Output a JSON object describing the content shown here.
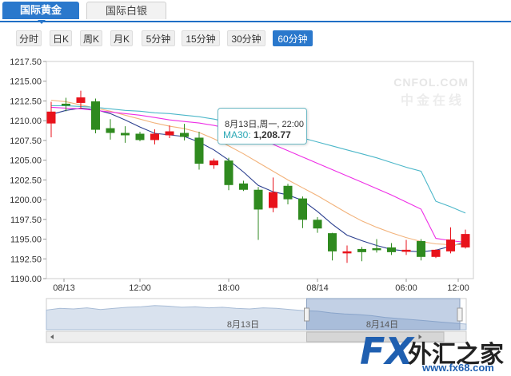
{
  "tabs": [
    {
      "label": "国际黄金",
      "active": true
    },
    {
      "label": "国际白银",
      "active": false
    }
  ],
  "periods": [
    {
      "label": "分时",
      "selected": false
    },
    {
      "label": "日K",
      "selected": false
    },
    {
      "label": "周K",
      "selected": false
    },
    {
      "label": "月K",
      "selected": false
    },
    {
      "label": "5分钟",
      "selected": false
    },
    {
      "label": "15分钟",
      "selected": false
    },
    {
      "label": "30分钟",
      "selected": false
    },
    {
      "label": "60分钟",
      "selected": true
    }
  ],
  "tooltip": {
    "time": "8月13日,周一, 22:00",
    "label": "MA30:",
    "value": "1,208.77"
  },
  "watermark": {
    "line1": "CNFOL.COM",
    "line2": "中金在线"
  },
  "navigator": {
    "label1": "8月13日",
    "label2": "8月14日"
  },
  "logo": {
    "fx": "FX",
    "name": "外汇之家",
    "url": "www.fx68.com"
  },
  "colors": {
    "up": "#e8121b",
    "down": "#2f8a1f",
    "ma_dark": "#2b3f8f",
    "ma_orange": "#f2b27a",
    "ma_magenta": "#ee2ee6",
    "ma_teal": "#4cb7c9",
    "accent": "#2a78cc"
  },
  "chart_data": {
    "type": "candlestick",
    "y_ticks": [
      "1190.00",
      "1192.50",
      "1195.00",
      "1197.50",
      "1200.00",
      "1202.50",
      "1205.00",
      "1207.50",
      "1210.00",
      "1212.50",
      "1215.00",
      "1217.50"
    ],
    "ylim": [
      1190.0,
      1217.5
    ],
    "x_ticks": [
      "08/13",
      "12:00",
      "18:00",
      "08/14",
      "06:00",
      "12:00"
    ],
    "candles": [
      {
        "o": 1209.7,
        "h": 1212.4,
        "l": 1207.9,
        "c": 1211.1
      },
      {
        "o": 1212.1,
        "h": 1212.9,
        "l": 1211.2,
        "c": 1212.0
      },
      {
        "o": 1212.3,
        "h": 1213.8,
        "l": 1211.5,
        "c": 1212.9
      },
      {
        "o": 1212.4,
        "h": 1212.8,
        "l": 1208.4,
        "c": 1208.9
      },
      {
        "o": 1209.0,
        "h": 1210.2,
        "l": 1207.6,
        "c": 1208.5
      },
      {
        "o": 1208.4,
        "h": 1209.3,
        "l": 1207.2,
        "c": 1208.2
      },
      {
        "o": 1208.3,
        "h": 1208.6,
        "l": 1207.4,
        "c": 1207.6
      },
      {
        "o": 1207.6,
        "h": 1208.9,
        "l": 1207.0,
        "c": 1208.3
      },
      {
        "o": 1208.2,
        "h": 1209.4,
        "l": 1207.8,
        "c": 1208.6
      },
      {
        "o": 1208.4,
        "h": 1209.6,
        "l": 1207.5,
        "c": 1208.0
      },
      {
        "o": 1207.8,
        "h": 1208.6,
        "l": 1203.8,
        "c": 1204.6
      },
      {
        "o": 1204.4,
        "h": 1205.2,
        "l": 1203.9,
        "c": 1204.9
      },
      {
        "o": 1204.9,
        "h": 1205.3,
        "l": 1201.2,
        "c": 1201.9
      },
      {
        "o": 1202.0,
        "h": 1202.4,
        "l": 1201.1,
        "c": 1201.3
      },
      {
        "o": 1201.2,
        "h": 1201.6,
        "l": 1194.9,
        "c": 1198.8
      },
      {
        "o": 1199.0,
        "h": 1202.8,
        "l": 1198.4,
        "c": 1200.9
      },
      {
        "o": 1201.7,
        "h": 1202.0,
        "l": 1199.4,
        "c": 1200.1
      },
      {
        "o": 1200.1,
        "h": 1200.4,
        "l": 1196.4,
        "c": 1197.5
      },
      {
        "o": 1197.4,
        "h": 1197.8,
        "l": 1195.8,
        "c": 1196.4
      },
      {
        "o": 1195.7,
        "h": 1195.8,
        "l": 1192.3,
        "c": 1193.5
      },
      {
        "o": 1193.3,
        "h": 1194.2,
        "l": 1192.0,
        "c": 1193.4
      },
      {
        "o": 1193.7,
        "h": 1194.0,
        "l": 1192.2,
        "c": 1193.4
      },
      {
        "o": 1193.8,
        "h": 1195.0,
        "l": 1193.3,
        "c": 1193.7
      },
      {
        "o": 1193.9,
        "h": 1194.5,
        "l": 1193.0,
        "c": 1193.4
      },
      {
        "o": 1193.6,
        "h": 1194.9,
        "l": 1193.0,
        "c": 1193.6
      },
      {
        "o": 1194.7,
        "h": 1195.0,
        "l": 1192.3,
        "c": 1192.8
      },
      {
        "o": 1192.8,
        "h": 1193.7,
        "l": 1192.6,
        "c": 1193.6
      },
      {
        "o": 1193.5,
        "h": 1196.5,
        "l": 1193.2,
        "c": 1194.9
      },
      {
        "o": 1194.0,
        "h": 1196.2,
        "l": 1193.8,
        "c": 1195.6
      }
    ],
    "series": [
      {
        "name": "MA5",
        "values": [
          1210.8,
          1211.3,
          1211.6,
          1211.4,
          1210.9,
          1210.1,
          1209.2,
          1208.4,
          1208.2,
          1208.0,
          1207.3,
          1206.3,
          1205.0,
          1203.5,
          1201.8,
          1201.0,
          1200.6,
          1199.9,
          1198.5,
          1196.9,
          1195.5,
          1194.8,
          1194.2,
          1193.7,
          1193.5,
          1193.4,
          1193.6,
          1194.1,
          1194.6
        ]
      },
      {
        "name": "MA10",
        "values": [
          1212.6,
          1212.4,
          1212.0,
          1211.6,
          1211.2,
          1210.7,
          1210.2,
          1209.7,
          1209.3,
          1209.0,
          1208.5,
          1207.7,
          1206.8,
          1205.8,
          1204.7,
          1203.6,
          1202.5,
          1201.5,
          1200.5,
          1199.4,
          1198.3,
          1197.3,
          1196.5,
          1195.8,
          1195.2,
          1194.7,
          1194.4,
          1194.3,
          1194.3
        ]
      },
      {
        "name": "MA20",
        "values": [
          1211.7,
          1211.6,
          1211.5,
          1211.3,
          1211.1,
          1210.9,
          1210.7,
          1210.4,
          1210.1,
          1209.9,
          1209.7,
          1209.4,
          1209.0,
          1208.4,
          1207.7,
          1207.0,
          1206.2,
          1205.4,
          1204.6,
          1203.8,
          1203.0,
          1202.2,
          1201.4,
          1200.6,
          1199.7,
          1198.8,
          1195.1,
          1194.8,
          1194.6
        ]
      },
      {
        "name": "MA30",
        "values": [
          1211.9,
          1211.9,
          1211.8,
          1211.7,
          1211.5,
          1211.3,
          1211.2,
          1211.0,
          1210.9,
          1210.7,
          1210.5,
          1210.2,
          1209.8,
          1209.4,
          1208.8,
          1208.5,
          1208.2,
          1207.8,
          1207.3,
          1206.8,
          1206.3,
          1205.8,
          1205.3,
          1204.7,
          1204.1,
          1203.6,
          1199.8,
          1199.1,
          1198.3
        ]
      }
    ],
    "navigator": {
      "values": [
        0.35,
        0.38,
        0.37,
        0.39,
        0.36,
        0.38,
        0.4,
        0.41,
        0.43,
        0.42,
        0.4,
        0.41,
        0.39,
        0.4,
        0.38,
        0.37,
        0.39,
        0.38,
        0.36,
        0.34,
        0.33,
        0.3,
        0.28,
        0.27,
        0.25,
        0.22,
        0.2,
        0.18,
        0.16,
        0.14,
        0.12,
        0.1
      ],
      "window_start": 0.62
    }
  }
}
